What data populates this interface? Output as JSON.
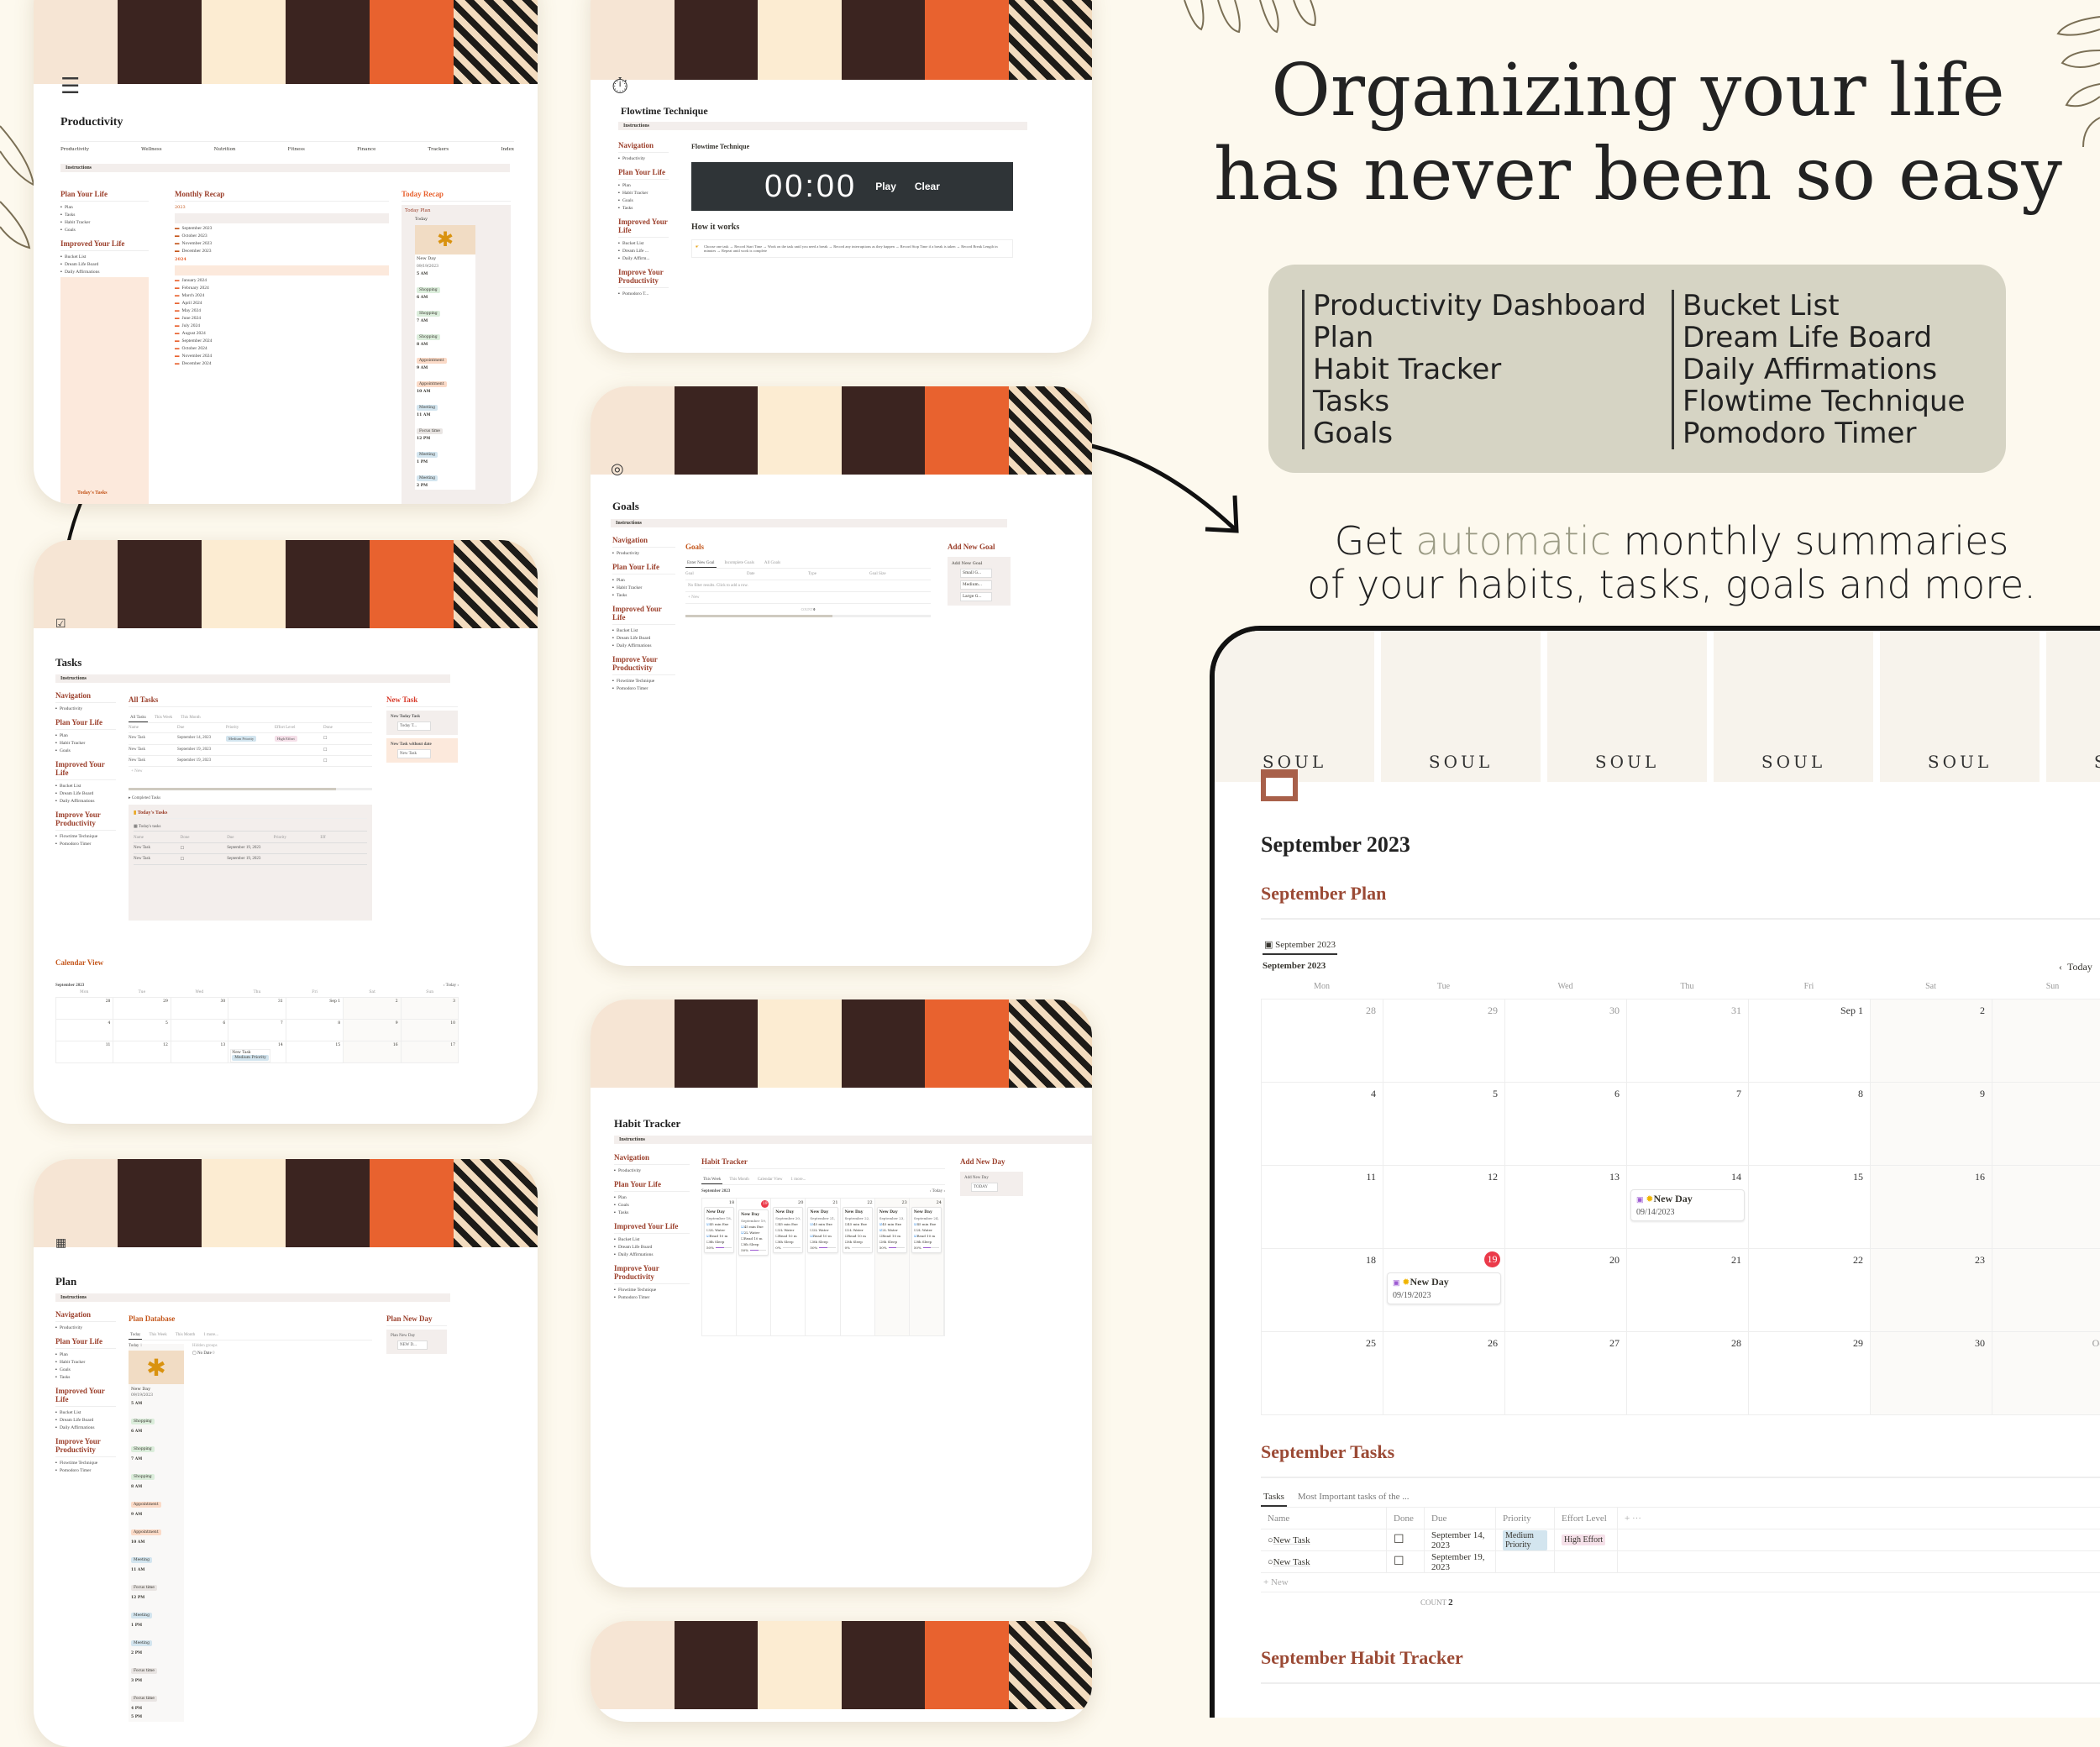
{
  "hero": {
    "title_line1": "Organizing your life",
    "title_line2": "has never been so easy",
    "features_left": [
      "Productivity Dashboard",
      "Plan",
      "Habit Tracker",
      "Tasks",
      "Goals"
    ],
    "features_right": [
      "Bucket List",
      "Dream Life Board",
      "Daily Affirmations",
      "Flowtime Technique",
      "Pomodoro Timer"
    ],
    "sub_pre": "Get ",
    "sub_accent": "automatic",
    "sub_post": " monthly summaries",
    "sub_line2": "of your habits, tasks, goals and more.",
    "accent_color": "#9a9a84"
  },
  "colors": {
    "heading_brown": "#9b3f2b",
    "heading_orange": "#c4561b",
    "today_red": "#eb3a4a",
    "bg": "#fdf9ee"
  },
  "productivity": {
    "title": "Productivity",
    "tabs": [
      "Productivity",
      "Wellness",
      "Nutrition",
      "Fitness",
      "Finance",
      "Trackers",
      "Index"
    ],
    "instructions": "Instructions",
    "plan_your_life": {
      "heading": "Plan Your Life",
      "items": [
        "Plan",
        "Tasks",
        "Habit Tracker",
        "Goals"
      ]
    },
    "improved_your_life": {
      "heading": "Improved Your Life",
      "items": [
        "Bucket List",
        "Dream Life Board",
        "Daily Affirmations"
      ]
    },
    "improve_productivity": {
      "heading": "Improve Your Productivity",
      "items": [
        "Flowtime Technique",
        "Pomodoro Timer"
      ]
    },
    "todays_tasks": "Today's Tasks",
    "monthly_recap": {
      "heading": "Monthly Recap",
      "year1": "2023",
      "months1": [
        "September 2023",
        "October 2023",
        "November 2023",
        "December 2023"
      ],
      "year2": "2024",
      "months2": [
        "January 2024",
        "February 2024",
        "March 2024",
        "April 2024",
        "May 2024",
        "June 2024",
        "July 2024",
        "August 2024",
        "September 2024",
        "October 2024",
        "November 2024",
        "December 2024"
      ]
    },
    "today_recap": {
      "heading": "Today Recap",
      "plan": "Today Plan",
      "view": "Today",
      "group": "Today",
      "group_count": "1",
      "hidden": "Hide",
      "entry": "New Day",
      "date": "09/19/2023",
      "schedule": [
        {
          "time": "5 AM",
          "tag": "Shopping",
          "c": "g"
        },
        {
          "time": "6 AM",
          "tag": "Shopping",
          "c": "g"
        },
        {
          "time": "7 AM",
          "tag": "Shopping",
          "c": "g"
        },
        {
          "time": "8 AM",
          "tag": "Appointment",
          "c": "o"
        },
        {
          "time": "9 AM",
          "tag": "Appointment",
          "c": "o"
        },
        {
          "time": "10 AM",
          "tag": "Meeting",
          "c": "b"
        },
        {
          "time": "11 AM",
          "tag": "Focus time",
          "c": "gr"
        },
        {
          "time": "12 PM",
          "tag": "Meeting",
          "c": "b"
        },
        {
          "time": "1 PM",
          "tag": "Meeting",
          "c": "b"
        },
        {
          "time": "2 PM",
          "tag": "",
          "c": ""
        }
      ]
    }
  },
  "flowtime": {
    "title": "Flowtime Technique",
    "instructions": "Instructions",
    "nav": {
      "navigation": "Navigation",
      "nav_items": [
        "Productivity"
      ],
      "plan_heading": "Plan Your Life",
      "plan_items": [
        "Plan",
        "Habit Tracker",
        "Goals",
        "Tasks"
      ],
      "improved_heading": "Improved Your Life",
      "improved_items": [
        "Bucket List",
        "Dream Life ...",
        "Daily Affirm..."
      ],
      "prod_heading": "Improve Your Productivity",
      "prod_items": [
        "Pomodoro T..."
      ]
    },
    "widget_title": "Flowtime Technique",
    "timer": "00:00",
    "play": "Play",
    "clear": "Clear",
    "how_heading": "How it works",
    "how_text": "Choose one task → Record Start Time → Work on the task until you need a break → Record any interruptions as they happen → Record Stop Time if a break is taken → Record Break Length in minutes → Repeat until work is complete"
  },
  "goals": {
    "title": "Goals",
    "instructions": "Instructions",
    "nav": {
      "navigation": "Navigation",
      "nav_items": [
        "Productivity"
      ],
      "plan_heading": "Plan Your Life",
      "plan_items": [
        "Plan",
        "Habit Tracker",
        "Tasks"
      ],
      "improved_heading": "Improved Your Life",
      "improved_items": [
        "Bucket List",
        "Dream Life Board",
        "Daily Affirmations"
      ],
      "prod_heading": "Improve Your Productivity",
      "prod_items": [
        "Flowtime Technique",
        "Pomodoro Timer"
      ]
    },
    "db_heading": "Goals",
    "views": [
      "Enter New Goal",
      "Incomplete Goals",
      "All Goals"
    ],
    "columns": [
      "Goal",
      "Date",
      "Type",
      "Goal Size"
    ],
    "empty": "No filter results. Click to add a row.",
    "new": "New",
    "count_label": "COUNT",
    "count": "0",
    "add_heading": "Add New Goal",
    "add_button": "Add New Goal",
    "sizes": [
      "Small G...",
      "Medium...",
      "Large G..."
    ]
  },
  "tasks": {
    "title": "Tasks",
    "instructions": "Instructions",
    "nav": {
      "navigation": "Navigation",
      "nav_items": [
        "Productivity"
      ],
      "plan_heading": "Plan Your Life",
      "plan_items": [
        "Plan",
        "Habit Tracker",
        "Goals"
      ],
      "improved_heading": "Improved Your Life",
      "improved_items": [
        "Bucket List",
        "Dream Life Board",
        "Daily Affirmations"
      ],
      "prod_heading": "Improve Your Productivity",
      "prod_items": [
        "Flowtime Technique",
        "Pomodoro Timer"
      ]
    },
    "all_heading": "All Tasks",
    "views": [
      "All Tasks",
      "This Week",
      "This Month"
    ],
    "columns": [
      "Name",
      "Due",
      "Priority",
      "Effort Level",
      "Done"
    ],
    "rows": [
      {
        "name": "New Task",
        "due": "September 14, 2023",
        "priority": "Medium Priority",
        "effort": "High Effort"
      },
      {
        "name": "New Task",
        "due": "September 19, 2023",
        "priority": "",
        "effort": ""
      },
      {
        "name": "New Task",
        "due": "September 19, 2023",
        "priority": "",
        "effort": ""
      }
    ],
    "new": "New",
    "completed": "Completed Tasks",
    "today_heading": "Today's Tasks",
    "today_view": "Today's tasks",
    "today_columns": [
      "Name",
      "Done",
      "Due",
      "Priority",
      "Eff"
    ],
    "today_rows": [
      {
        "name": "New Task",
        "due": "September 19, 2023"
      },
      {
        "name": "New Task",
        "due": "September 19, 2023"
      }
    ],
    "new_task_heading": "New Task",
    "new_today": "New Today Task",
    "new_today_btn": "Today T...",
    "new_nodate": "New Task without date",
    "new_nodate_btn": "New Task",
    "calendar_heading": "Calendar View",
    "cal_month": "September 2023",
    "cal_today": "Today",
    "days": [
      "Mon",
      "Tue",
      "Wed",
      "Thu",
      "Fri",
      "Sat",
      "Sun"
    ],
    "weeks": [
      [
        "28",
        "29",
        "30",
        "31",
        "Sep 1",
        "2",
        "3"
      ],
      [
        "4",
        "5",
        "6",
        "7",
        "8",
        "9",
        "10"
      ],
      [
        "11",
        "12",
        "13",
        "14",
        "15",
        "16",
        "17"
      ]
    ],
    "cal_event": {
      "name": "New Task",
      "tag": "Medium Priority"
    }
  },
  "plan": {
    "title": "Plan",
    "instructions": "Instructions",
    "nav": {
      "navigation": "Navigation",
      "nav_items": [
        "Productivity"
      ],
      "plan_heading": "Plan Your Life",
      "plan_items": [
        "Plan",
        "Habit Tracker",
        "Goals",
        "Tasks"
      ],
      "improved_heading": "Improved Your Life",
      "improved_items": [
        "Bucket List",
        "Dream Life Board",
        "Daily Affirmations"
      ],
      "prod_heading": "Improve Your Productivity",
      "prod_items": [
        "Flowtime Technique",
        "Pomodoro Timer"
      ]
    },
    "db_heading": "Plan Database",
    "views": [
      "Today",
      "This Week",
      "This Month",
      "1 more..."
    ],
    "group": "Today",
    "group_count": "1",
    "hidden_groups": "Hidden groups",
    "no_date": "No Date",
    "no_date_count": "0",
    "entry": "New Day",
    "date": "09/19/2023",
    "schedule": [
      {
        "time": "5 AM",
        "tag": "Shopping",
        "c": "g"
      },
      {
        "time": "6 AM",
        "tag": "Shopping",
        "c": "g"
      },
      {
        "time": "7 AM",
        "tag": "Shopping",
        "c": "g"
      },
      {
        "time": "8 AM",
        "tag": "Appointment",
        "c": "o"
      },
      {
        "time": "9 AM",
        "tag": "Appointment",
        "c": "o"
      },
      {
        "time": "10 AM",
        "tag": "Meeting",
        "c": "b"
      },
      {
        "time": "11 AM",
        "tag": "Focus time",
        "c": "gr"
      },
      {
        "time": "12 PM",
        "tag": "Meeting",
        "c": "b"
      },
      {
        "time": "1 PM",
        "tag": "Meeting",
        "c": "b"
      },
      {
        "time": "2 PM",
        "tag": "Focus time",
        "c": "gr"
      },
      {
        "time": "3 PM",
        "tag": "Focus time",
        "c": "gr"
      },
      {
        "time": "4 PM",
        "tag": "",
        "c": ""
      },
      {
        "time": "5 PM",
        "tag": "",
        "c": ""
      }
    ],
    "new_day_heading": "Plan New Day",
    "new_day_btn": "Plan New Day",
    "new_day_sub": "NEW D..."
  },
  "habit": {
    "title": "Habit Tracker",
    "instructions": "Instructions",
    "nav": {
      "navigation": "Navigation",
      "nav_items": [
        "Productivity"
      ],
      "plan_heading": "Plan Your Life",
      "plan_items": [
        "Plan",
        "Goals",
        "Tasks"
      ],
      "improved_heading": "Improved Your Life",
      "improved_items": [
        "Bucket List",
        "Dream Life Board",
        "Daily Affirmations"
      ],
      "prod_heading": "Improve Your Productivity",
      "prod_items": [
        "Flowtime Technique",
        "Pomodoro Timer"
      ]
    },
    "db_heading": "Habit Tracker",
    "views": [
      "This Week",
      "This Month",
      "Calendar View",
      "1 more..."
    ],
    "month": "September 2023",
    "today": "Today",
    "days": [
      "Mon",
      "Tue",
      "Wed",
      "Thu",
      "Fri",
      "Sat",
      "Sun"
    ],
    "habits": [
      "45 min Exe",
      "2L Water",
      "Read 10 m",
      "8h Sleep"
    ],
    "cards": [
      {
        "day": "18",
        "date": "September 18,",
        "checks": [
          true,
          false,
          true,
          false
        ],
        "pct": "50%",
        "fill": 0.5
      },
      {
        "day": "19",
        "date": "September 19,",
        "checks": [
          true,
          true,
          false,
          false
        ],
        "pct": "50%",
        "fill": 0.5,
        "today": true
      },
      {
        "day": "20",
        "date": "September 20,",
        "checks": [
          false,
          false,
          false,
          false
        ],
        "pct": "0%",
        "fill": 0
      },
      {
        "day": "21",
        "date": "September 21,",
        "checks": [
          true,
          false,
          true,
          false
        ],
        "pct": "50%",
        "fill": 0.5
      },
      {
        "day": "22",
        "date": "September 22,",
        "checks": [
          false,
          false,
          false,
          false
        ],
        "pct": "0%",
        "fill": 0
      },
      {
        "day": "23",
        "date": "September 23,",
        "checks": [
          true,
          true,
          false,
          false
        ],
        "pct": "50%",
        "fill": 0.5
      },
      {
        "day": "24",
        "date": "September 24,",
        "checks": [
          true,
          false,
          true,
          false
        ],
        "pct": "50%",
        "fill": 0.5
      }
    ],
    "card_title": "New Day",
    "add_heading": "Add New Day",
    "add_btn": "Add New Day",
    "add_sub": "TODAY"
  },
  "september": {
    "banner_word": "SOUL",
    "title": "September 2023",
    "plan_heading": "September Plan",
    "view_tab": "September 2023",
    "cal_month": "September 2023",
    "today": "Today",
    "days": [
      "Mon",
      "Tue",
      "Wed",
      "Thu",
      "Fri",
      "Sat",
      "Sun"
    ],
    "weeks": [
      [
        "28",
        "29",
        "30",
        "31",
        "Sep 1",
        "2",
        ""
      ],
      [
        "4",
        "5",
        "6",
        "7",
        "8",
        "9",
        ""
      ],
      [
        "11",
        "12",
        "13",
        "14",
        "15",
        "16",
        ""
      ],
      [
        "18",
        "19",
        "20",
        "21",
        "22",
        "23",
        ""
      ],
      [
        "25",
        "26",
        "27",
        "28",
        "29",
        "30",
        "Oct"
      ]
    ],
    "events": [
      {
        "week": 2,
        "day": 3,
        "name": "New Day",
        "date": "09/14/2023"
      },
      {
        "week": 3,
        "day": 1,
        "name": "New Day",
        "date": "09/19/2023"
      }
    ],
    "today_cell": {
      "week": 3,
      "day": 1
    },
    "tasks_heading": "September Tasks",
    "task_views": [
      "Tasks",
      "Most Important tasks of the ..."
    ],
    "task_columns": [
      "Name",
      "Done",
      "Due",
      "Priority",
      "Effort Level"
    ],
    "task_rows": [
      {
        "name": "New Task",
        "due": "September 14, 2023",
        "priority": "Medium Priority",
        "effort": "High Effort"
      },
      {
        "name": "New Task",
        "due": "September 19, 2023",
        "priority": "",
        "effort": ""
      }
    ],
    "new": "New",
    "count_label": "COUNT",
    "count": "2",
    "habit_heading": "September Habit Tracker"
  }
}
